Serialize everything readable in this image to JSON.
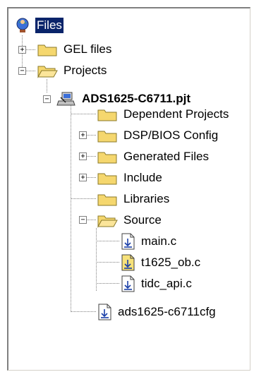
{
  "tree": {
    "root": {
      "label": "Files",
      "icon": "globe-person-icon",
      "selected": true
    },
    "items": [
      {
        "label": "GEL files",
        "icon": "folder-closed-icon",
        "expander": "+"
      },
      {
        "label": "Projects",
        "icon": "folder-open-icon",
        "expander": "−"
      },
      {
        "label": "ADS1625-C6711.pjt",
        "icon": "project-icon",
        "expander": "−"
      },
      {
        "label": "Dependent Projects",
        "icon": "folder-closed-icon"
      },
      {
        "label": "DSP/BIOS Config",
        "icon": "folder-closed-icon",
        "expander": "+"
      },
      {
        "label": "Generated Files",
        "icon": "folder-closed-icon",
        "expander": "+"
      },
      {
        "label": "Include",
        "icon": "folder-closed-icon",
        "expander": "+"
      },
      {
        "label": "Libraries",
        "icon": "folder-closed-icon"
      },
      {
        "label": "Source",
        "icon": "folder-open-icon",
        "expander": "−"
      },
      {
        "label": "main.c",
        "icon": "c-file-icon"
      },
      {
        "label": "t1625_ob.c",
        "icon": "c-file-icon"
      },
      {
        "label": "tidc_api.c",
        "icon": "c-file-icon"
      },
      {
        "label": "ads1625-c6711cfg",
        "icon": "c-file-icon"
      }
    ]
  },
  "colors": {
    "selection": "#0a246a",
    "folder": "#f5d76e",
    "folder_edge": "#8a7a2a"
  }
}
